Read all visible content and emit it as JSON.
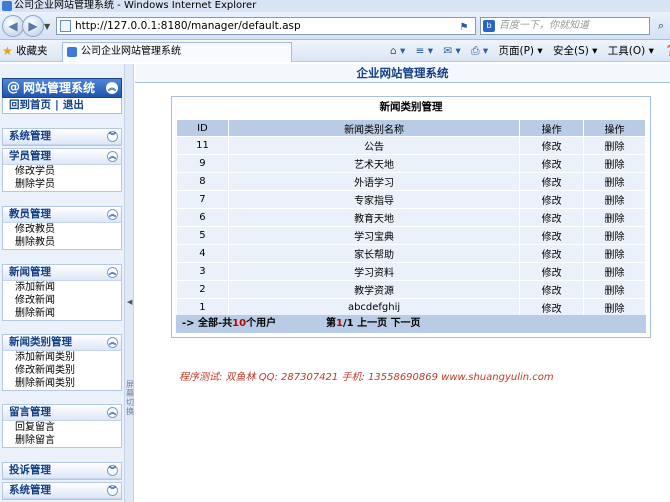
{
  "window": {
    "title": "公司企业网站管理系统 - Windows Internet Explorer"
  },
  "browser": {
    "url": "http://127.0.0.1:8180/manager/default.asp",
    "search_placeholder": "百度一下，你就知道",
    "favorites_label": "收藏夹",
    "tab_title": "公司企业网站管理系统",
    "menus": {
      "page": "页面(P)",
      "safety": "安全(S)",
      "tools": "工具(O)"
    }
  },
  "sidebar": {
    "system_title": "网站管理系统",
    "home_link": "回到首页",
    "logout_link": "退出",
    "sections": [
      {
        "title": "系统管理",
        "items": []
      },
      {
        "title": "学员管理",
        "items": [
          "修改学员",
          "删除学员"
        ]
      },
      {
        "title": "教员管理",
        "items": [
          "修改教员",
          "删除教员"
        ]
      },
      {
        "title": "新闻管理",
        "items": [
          "添加新闻",
          "修改新闻",
          "删除新闻"
        ]
      },
      {
        "title": "新闻类别管理",
        "items": [
          "添加新闻类别",
          "修改新闻类别",
          "删除新闻类别"
        ]
      },
      {
        "title": "留言管理",
        "items": [
          "回复留言",
          "删除留言"
        ]
      },
      {
        "title": "投诉管理",
        "items": []
      },
      {
        "title": "系统管理",
        "items": []
      }
    ],
    "toggle_text": "屏幕切换"
  },
  "main": {
    "header": "企业网站管理系统",
    "panel_title": "新闻类别管理",
    "columns": [
      "ID",
      "新闻类别名称",
      "操作",
      "操作"
    ],
    "rows": [
      {
        "id": "11",
        "name": "公告",
        "edit": "修改",
        "delete": "删除"
      },
      {
        "id": "9",
        "name": "艺术天地",
        "edit": "修改",
        "delete": "删除"
      },
      {
        "id": "8",
        "name": "外语学习",
        "edit": "修改",
        "delete": "删除"
      },
      {
        "id": "7",
        "name": "专家指导",
        "edit": "修改",
        "delete": "删除"
      },
      {
        "id": "6",
        "name": "教育天地",
        "edit": "修改",
        "delete": "删除"
      },
      {
        "id": "5",
        "name": "学习宝典",
        "edit": "修改",
        "delete": "删除"
      },
      {
        "id": "4",
        "name": "家长帮助",
        "edit": "修改",
        "delete": "删除"
      },
      {
        "id": "3",
        "name": "学习资料",
        "edit": "修改",
        "delete": "删除"
      },
      {
        "id": "2",
        "name": "教学资源",
        "edit": "修改",
        "delete": "删除"
      },
      {
        "id": "1",
        "name": "abcdefghij",
        "edit": "修改",
        "delete": "删除"
      }
    ],
    "footer": {
      "all_prefix": "-> 全部-共",
      "total": "10",
      "all_suffix": "个用户",
      "page_prefix": "第",
      "page_current": "1",
      "page_total": "/1",
      "prev": "上一页",
      "next": "下一页"
    },
    "credit": "程序测试: 双鱼林  QQ: 287307421  手机: 13558690869  www.shuangyulin.com"
  }
}
